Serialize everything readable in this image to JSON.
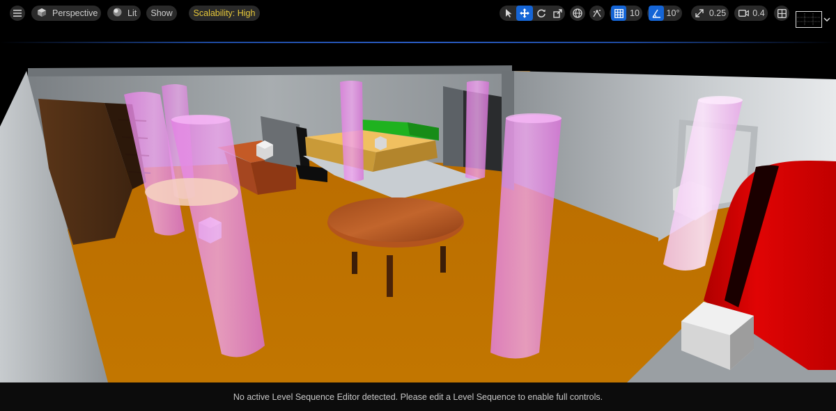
{
  "toolbar": {
    "menu_icon": "hamburger-menu-icon",
    "perspective_label": "Perspective",
    "lit_label": "Lit",
    "show_label": "Show",
    "scalability_label": "Scalability: High",
    "grid_snap_value": "10",
    "rotation_snap_value": "10°",
    "scale_snap_value": "0.25",
    "camera_speed_value": "0.4"
  },
  "status": {
    "message": "No active Level Sequence Editor detected. Please edit a Level Sequence to enable full controls."
  },
  "colors": {
    "floor": "#c07200",
    "wall": "#9aa0a4",
    "pink_volume": "#e88ae8",
    "sofa_red": "#d40000",
    "bed_green": "#1fb21f",
    "active_blue": "#1565d6",
    "scalability_yellow": "#e8c93a"
  }
}
